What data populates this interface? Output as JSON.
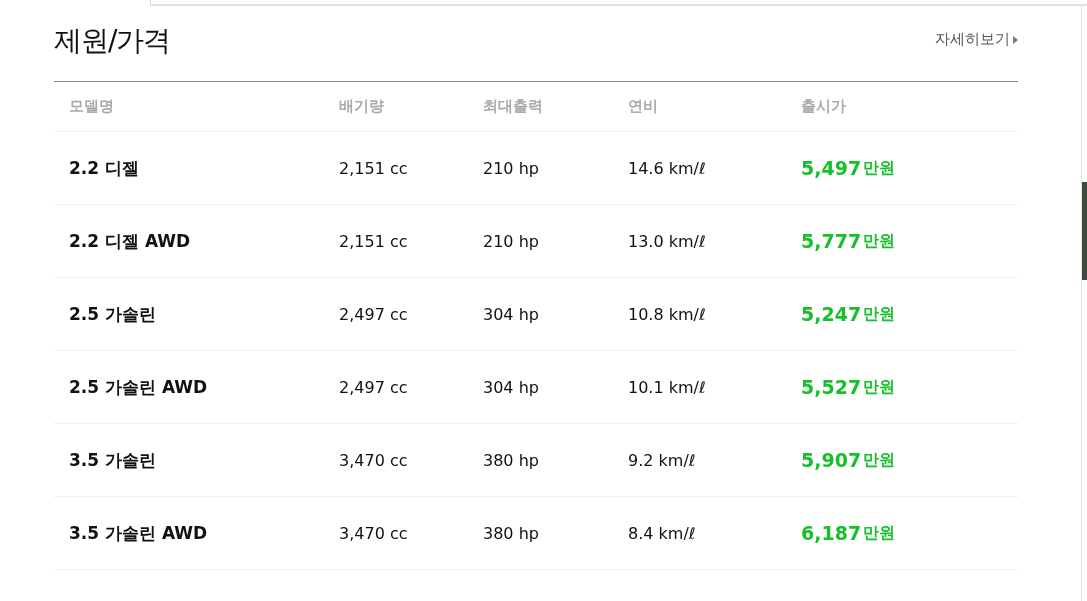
{
  "section": {
    "title": "제원/가격",
    "more_link": "자세히보기"
  },
  "table": {
    "columns": [
      "모델명",
      "배기량",
      "최대출력",
      "연비",
      "출시가"
    ],
    "rows": [
      {
        "model": "2.2 디젤",
        "displacement": "2,151 cc",
        "power": "210 hp",
        "mileage": "14.6 km/ℓ",
        "price": "5,497",
        "price_unit": "만원"
      },
      {
        "model": "2.2 디젤 AWD",
        "displacement": "2,151 cc",
        "power": "210 hp",
        "mileage": "13.0 km/ℓ",
        "price": "5,777",
        "price_unit": "만원"
      },
      {
        "model": "2.5 가솔린",
        "displacement": "2,497 cc",
        "power": "304 hp",
        "mileage": "10.8 km/ℓ",
        "price": "5,247",
        "price_unit": "만원"
      },
      {
        "model": "2.5 가솔린 AWD",
        "displacement": "2,497 cc",
        "power": "304 hp",
        "mileage": "10.1 km/ℓ",
        "price": "5,527",
        "price_unit": "만원"
      },
      {
        "model": "3.5 가솔린",
        "displacement": "3,470 cc",
        "power": "380 hp",
        "mileage": "9.2 km/ℓ",
        "price": "5,907",
        "price_unit": "만원"
      },
      {
        "model": "3.5 가솔린 AWD",
        "displacement": "3,470 cc",
        "power": "380 hp",
        "mileage": "8.4 km/ℓ",
        "price": "6,187",
        "price_unit": "만원"
      }
    ]
  }
}
